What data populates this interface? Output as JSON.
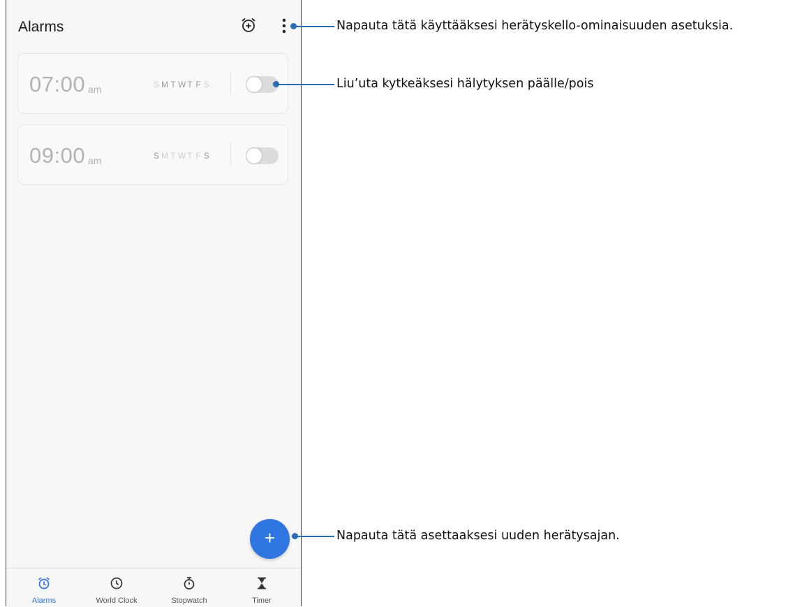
{
  "app": {
    "title": "Alarms"
  },
  "header_icons": {
    "add_alarm": "alarm-add-icon",
    "more": "more-vertical-icon"
  },
  "alarms": [
    {
      "time": "07:00",
      "ampm": "am",
      "days": [
        {
          "letter": "S",
          "active": false
        },
        {
          "letter": "M",
          "active": true
        },
        {
          "letter": "T",
          "active": true
        },
        {
          "letter": "W",
          "active": true
        },
        {
          "letter": "T",
          "active": true
        },
        {
          "letter": "F",
          "active": true
        },
        {
          "letter": "S",
          "active": false
        }
      ],
      "enabled": false
    },
    {
      "time": "09:00",
      "ampm": "am",
      "days": [
        {
          "letter": "S",
          "active": true
        },
        {
          "letter": "M",
          "active": false
        },
        {
          "letter": "T",
          "active": false
        },
        {
          "letter": "W",
          "active": false
        },
        {
          "letter": "T",
          "active": false
        },
        {
          "letter": "F",
          "active": false
        },
        {
          "letter": "S",
          "active": true
        }
      ],
      "enabled": false
    }
  ],
  "fab": {
    "label": "+"
  },
  "nav": [
    {
      "label": "Alarms",
      "icon": "alarm-icon",
      "active": true
    },
    {
      "label": "World Clock",
      "icon": "clock-icon",
      "active": false
    },
    {
      "label": "Stopwatch",
      "icon": "stopwatch-icon",
      "active": false
    },
    {
      "label": "Timer",
      "icon": "hourglass-icon",
      "active": false
    }
  ],
  "annotations": [
    "Napauta tätä käyttääksesi herätyskello-ominaisuuden asetuksia.",
    "Liu’uta kytkeäksesi hälytyksen päälle/pois",
    "Napauta tätä asettaaksesi uuden herätysajan."
  ],
  "colors": {
    "accent": "#2f76e2",
    "annotation": "#2a6cb3"
  }
}
